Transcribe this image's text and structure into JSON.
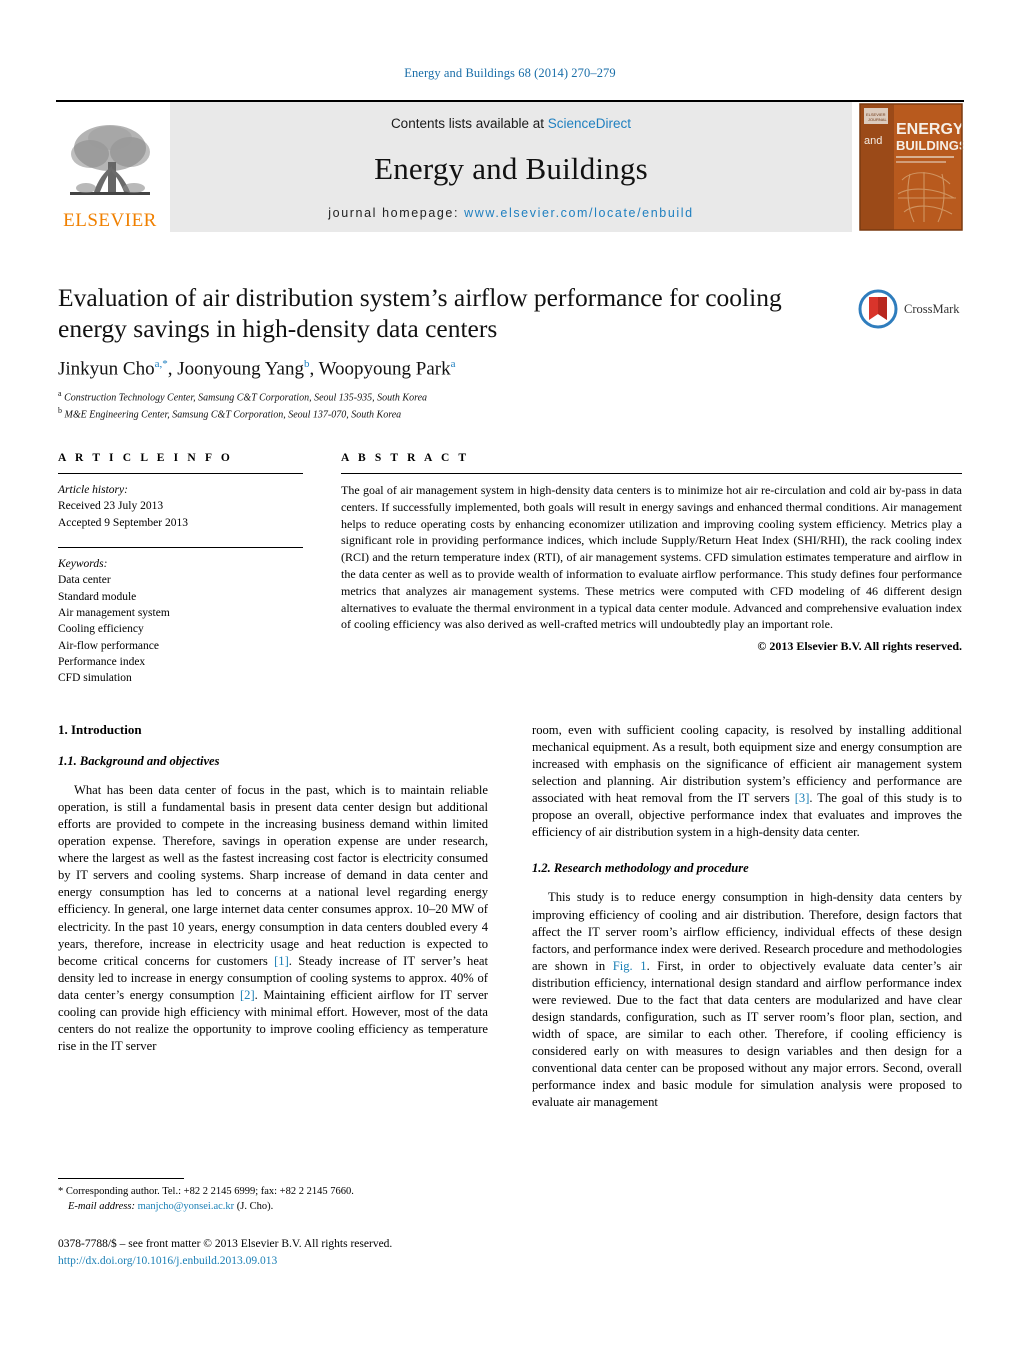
{
  "running_head": "Energy and Buildings 68 (2014) 270–279",
  "masthead": {
    "publisher_logo_label": "ELSEVIER",
    "contents_prefix": "Contents lists available at ",
    "contents_link": "ScienceDirect",
    "journal_title": "Energy and Buildings",
    "homepage_prefix": "journal homepage:",
    "homepage_url": "www.elsevier.com/locate/enbuild",
    "cover": {
      "title_line1": "ENERGY",
      "title_line2": "BUILDINGS",
      "title_small": "and"
    }
  },
  "article": {
    "title": "Evaluation of air distribution system’s airflow performance for cooling energy savings in high-density data centers",
    "authors": [
      {
        "name": "Jinkyun Cho",
        "marks": "a,*"
      },
      {
        "name": "Joonyoung Yang",
        "marks": "b"
      },
      {
        "name": "Woopyoung Park",
        "marks": "a"
      }
    ],
    "affiliations": [
      {
        "mark": "a",
        "text": "Construction Technology Center, Samsung C&T Corporation, Seoul 135-935, South Korea"
      },
      {
        "mark": "b",
        "text": "M&E Engineering Center, Samsung C&T Corporation, Seoul 137-070, South Korea"
      }
    ],
    "crossmark_label": "CrossMark"
  },
  "article_info": {
    "heading": "A R T I C L E    I N F O",
    "history_label": "Article history:",
    "history": [
      "Received 23 July 2013",
      "Accepted 9 September 2013"
    ],
    "keywords_label": "Keywords:",
    "keywords": [
      "Data center",
      "Standard module",
      "Air management system",
      "Cooling efficiency",
      "Air-flow performance",
      "Performance index",
      "CFD simulation"
    ]
  },
  "abstract": {
    "heading": "A B S T R A C T",
    "text": "The goal of air management system in high-density data centers is to minimize hot air re-circulation and cold air by-pass in data centers. If successfully implemented, both goals will result in energy savings and enhanced thermal conditions. Air management helps to reduce operating costs by enhancing economizer utilization and improving cooling system efficiency. Metrics play a significant role in providing performance indices, which include Supply/Return Heat Index (SHI/RHI), the rack cooling index (RCI) and the return temperature index (RTI), of air management systems. CFD simulation estimates temperature and airflow in the data center as well as to provide wealth of information to evaluate airflow performance. This study defines four performance metrics that analyzes air management systems. These metrics were computed with CFD modeling of 46 different design alternatives to evaluate the thermal environment in a typical data center module. Advanced and comprehensive evaluation index of cooling efficiency was also derived as well-crafted metrics will undoubtedly play an important role.",
    "copyright": "© 2013 Elsevier B.V. All rights reserved."
  },
  "sections": {
    "introduction_heading": "1.  Introduction",
    "sub1_heading": "1.1.  Background and objectives",
    "sub2_heading": "1.2.  Research methodology and procedure",
    "para1_a": "What has been data center of focus in the past, which is to maintain reliable operation, is still a fundamental basis in present data center design but additional efforts are provided to compete in the increasing business demand within limited operation expense. Therefore, savings in operation expense are under research, where the largest as well as the fastest increasing cost factor is electricity consumed by IT servers and cooling systems. Sharp increase of demand in data center and energy consumption has led to concerns at a national level regarding energy efficiency. In general, one large internet data center consumes approx. 10–20 MW of electricity. In the past 10 years, energy consumption in data centers doubled every 4 years, therefore, increase in electricity usage and heat reduction is expected to become critical concerns for customers ",
    "ref1": "[1]",
    "para1_b": ". Steady increase of IT server’s heat density led to increase in energy consumption of cooling systems to approx. 40% of data center’s energy consumption ",
    "ref2": "[2]",
    "para1_c": ". Maintaining efficient airflow for IT server cooling can provide high efficiency with minimal effort. However, most of the data centers do not realize the opportunity to improve cooling efficiency as temperature rise in the IT server ",
    "para2_a": "room, even with sufficient cooling capacity, is resolved by installing additional mechanical equipment. As a result, both equipment size and energy consumption are increased with emphasis on the significance of efficient air management system selection and planning. Air distribution system’s efficiency and performance are associated with heat removal from the IT servers ",
    "ref3": "[3]",
    "para2_b": ". The goal of this study is to propose an overall, objective performance index that evaluates and improves the efficiency of air distribution system in a high-density data center.",
    "para3_a": "This study is to reduce energy consumption in high-density data centers by improving efficiency of cooling and air distribution. Therefore, design factors that affect the IT server room’s airflow efficiency, individual effects of these design factors, and performance index were derived. Research procedure and methodologies are shown in ",
    "reffig": "Fig. 1",
    "para3_b": ". First, in order to objectively evaluate data center’s air distribution efficiency, international design standard and airflow performance index were reviewed. Due to the fact that data centers are modularized and have clear design standards, configuration, such as IT server room’s floor plan, section, and width of space, are similar to each other. Therefore, if cooling efficiency is considered early on with measures to design variables and then design for a conventional data center can be proposed without any major errors. Second, overall performance index and basic module for simulation analysis were proposed to evaluate air management"
  },
  "footnote": {
    "corresponding": "* Corresponding author. Tel.: +82 2 2145 6999; fax: +82 2 2145 7660.",
    "email_label": "E-mail address:",
    "email": "manjcho@yonsei.ac.kr",
    "email_suffix": "(J. Cho)."
  },
  "imprint": {
    "issn_line": "0378-7788/$ – see front matter © 2013 Elsevier B.V. All rights reserved.",
    "doi": "http://dx.doi.org/10.1016/j.enbuild.2013.09.013"
  },
  "colors": {
    "link": "#1a7fb5",
    "running_head": "#1a6ea8",
    "elsevier_orange": "#f08000",
    "masthead_bg": "#e9e9e9",
    "cover_orange": "#b85a1e"
  }
}
